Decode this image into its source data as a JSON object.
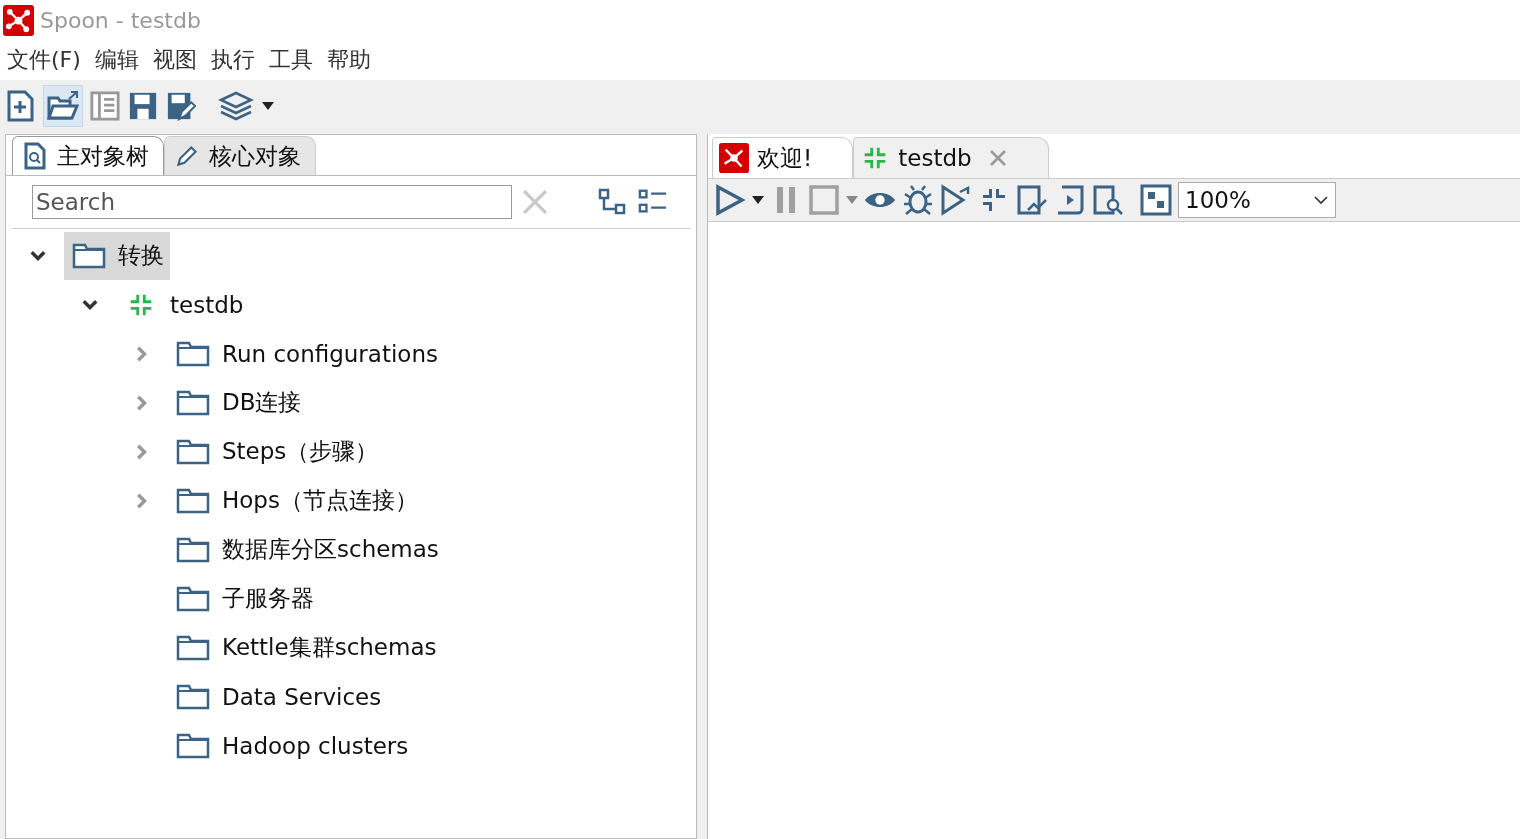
{
  "window": {
    "title": "Spoon - testdb"
  },
  "menu": [
    "文件(F)",
    "编辑",
    "视图",
    "执行",
    "工具",
    "帮助"
  ],
  "left_tabs": [
    {
      "label": "主对象树",
      "selected": true
    },
    {
      "label": "核心对象",
      "selected": false
    }
  ],
  "search": {
    "placeholder": "Search"
  },
  "tree": [
    {
      "label": "转换",
      "kind": "folder",
      "expandable": true,
      "expanded": true,
      "selected": true,
      "children": [
        {
          "label": "testdb",
          "kind": "transformation",
          "expandable": true,
          "expanded": true,
          "selected": false,
          "children": [
            {
              "label": "Run configurations",
              "kind": "folder",
              "expandable": true,
              "expanded": false,
              "selected": false
            },
            {
              "label": "DB连接",
              "kind": "folder",
              "expandable": true,
              "expanded": false,
              "selected": false
            },
            {
              "label": "Steps（步骤）",
              "kind": "folder",
              "expandable": true,
              "expanded": false,
              "selected": false
            },
            {
              "label": "Hops（节点连接）",
              "kind": "folder",
              "expandable": true,
              "expanded": false,
              "selected": false
            },
            {
              "label": "数据库分区schemas",
              "kind": "folder",
              "expandable": false,
              "selected": false
            },
            {
              "label": "子服务器",
              "kind": "folder",
              "expandable": false,
              "selected": false
            },
            {
              "label": "Kettle集群schemas",
              "kind": "folder",
              "expandable": false,
              "selected": false
            },
            {
              "label": "Data Services",
              "kind": "folder",
              "expandable": false,
              "selected": false
            },
            {
              "label": "Hadoop clusters",
              "kind": "folder",
              "expandable": false,
              "selected": false
            }
          ]
        }
      ]
    }
  ],
  "editor_tabs": [
    {
      "label": "欢迎!",
      "kind": "welcome",
      "selected": false,
      "closable": false
    },
    {
      "label": "testdb",
      "kind": "transformation",
      "selected": true,
      "closable": true
    }
  ],
  "zoom": {
    "value": "100%"
  }
}
